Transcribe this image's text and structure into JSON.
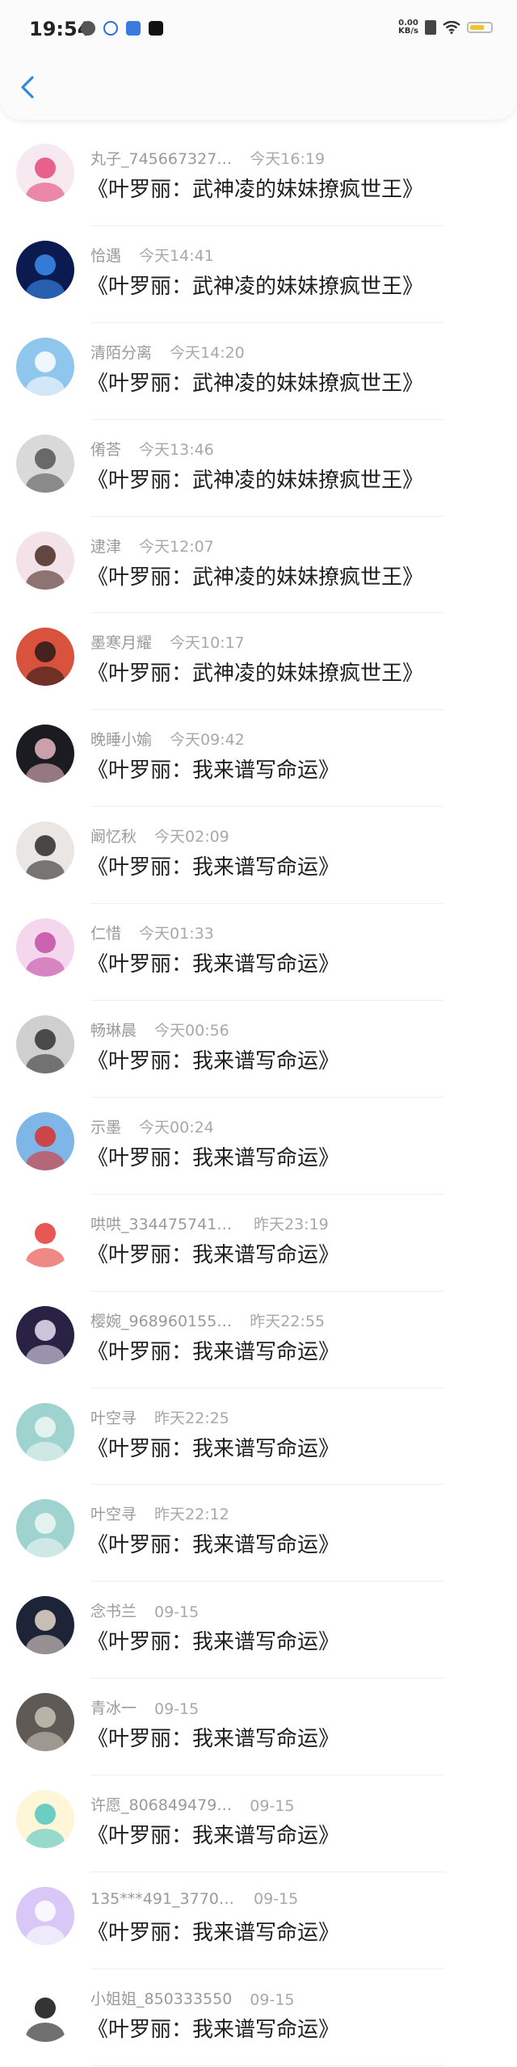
{
  "status_bar": {
    "time": "19:54",
    "net_speed_value": "0.00",
    "net_speed_unit": "KB/s"
  },
  "items": [
    {
      "name": "丸子_745667327…",
      "date": "今天16:19",
      "title": "《叶罗丽：武神凌的妹妹撩疯世王》",
      "avatar_color": "#f6e9ef",
      "avatar_accent": "#e5487a"
    },
    {
      "name": "恰遇",
      "date": "今天14:41",
      "title": "《叶罗丽：武神凌的妹妹撩疯世王》",
      "avatar_color": "#0b1a4f",
      "avatar_accent": "#3c8df0"
    },
    {
      "name": "清陌分离",
      "date": "今天14:20",
      "title": "《叶罗丽：武神凌的妹妹撩疯世王》",
      "avatar_color": "#8ec6ee",
      "avatar_accent": "#ffffff"
    },
    {
      "name": "倄荅",
      "date": "今天13:46",
      "title": "《叶罗丽：武神凌的妹妹撩疯世王》",
      "avatar_color": "#d9d9d9",
      "avatar_accent": "#555555"
    },
    {
      "name": "逮津",
      "date": "今天12:07",
      "title": "《叶罗丽：武神凌的妹妹撩疯世王》",
      "avatar_color": "#f3e2e8",
      "avatar_accent": "#4a2a22"
    },
    {
      "name": "墨寒月耀",
      "date": "今天10:17",
      "title": "《叶罗丽：武神凌的妹妹撩疯世王》",
      "avatar_color": "#d9523e",
      "avatar_accent": "#2a1a18"
    },
    {
      "name": "晚睡小媮",
      "date": "今天09:42",
      "title": "《叶罗丽：我来谱写命运》",
      "avatar_color": "#1b1b22",
      "avatar_accent": "#e8b7c3"
    },
    {
      "name": "阚忆秋",
      "date": "今天02:09",
      "title": "《叶罗丽：我来谱写命运》",
      "avatar_color": "#e9e6e3",
      "avatar_accent": "#2a2a2a"
    },
    {
      "name": "仁惜",
      "date": "今天01:33",
      "title": "《叶罗丽：我来谱写命运》",
      "avatar_color": "#f4d7ec",
      "avatar_accent": "#c24ea6"
    },
    {
      "name": "畅琳晨",
      "date": "今天00:56",
      "title": "《叶罗丽：我来谱写命运》",
      "avatar_color": "#cfcfcf",
      "avatar_accent": "#333333"
    },
    {
      "name": "示墨",
      "date": "今天00:24",
      "title": "《叶罗丽：我来谱写命运》",
      "avatar_color": "#7fb6e8",
      "avatar_accent": "#d8322b"
    },
    {
      "name": "哄哄_3344757413…",
      "date": "昨天23:19",
      "title": "《叶罗丽：我来谱写命运》",
      "avatar_color": "#ffffff",
      "avatar_accent": "#e43a35"
    },
    {
      "name": "樱婉_968960155…",
      "date": "昨天22:55",
      "title": "《叶罗丽：我来谱写命运》",
      "avatar_color": "#2a2244",
      "avatar_accent": "#e8e0f4"
    },
    {
      "name": "叶空寻",
      "date": "昨天22:25",
      "title": "《叶罗丽：我来谱写命运》",
      "avatar_color": "#9fd3cf",
      "avatar_accent": "#eef6f5"
    },
    {
      "name": "叶空寻",
      "date": "昨天22:12",
      "title": "《叶罗丽：我来谱写命运》",
      "avatar_color": "#9fd3cf",
      "avatar_accent": "#eef6f5"
    },
    {
      "name": "念书兰",
      "date": "09-15",
      "title": "《叶罗丽：我来谱写命运》",
      "avatar_color": "#1d2438",
      "avatar_accent": "#e7d8cf"
    },
    {
      "name": "青冰一",
      "date": "09-15",
      "title": "《叶罗丽：我来谱写命运》",
      "avatar_color": "#5f5a55",
      "avatar_accent": "#c9c2b8"
    },
    {
      "name": "许愿_806849479…",
      "date": "09-15",
      "title": "《叶罗丽：我来谱写命运》",
      "avatar_color": "#fff6d8",
      "avatar_accent": "#52c6c1"
    },
    {
      "name": "135***491_37704…",
      "date": "09-15",
      "title": "《叶罗丽：我来谱写命运》",
      "avatar_color": "#d8c7f7",
      "avatar_accent": "#ffffff"
    },
    {
      "name": "小姐姐_850333550",
      "date": "09-15",
      "title": "《叶罗丽：我来谱写命运》",
      "avatar_color": "#ffffff",
      "avatar_accent": "#111111"
    }
  ]
}
